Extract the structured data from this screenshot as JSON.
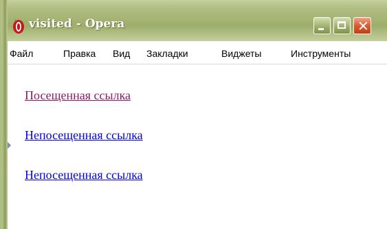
{
  "window": {
    "title": "visited - Opera",
    "icon": "opera-icon",
    "minimize_icon": "minimize-icon",
    "maximize_icon": "maximize-icon",
    "close_icon": "close-icon",
    "close_glyph": "✕"
  },
  "menu": {
    "items": [
      {
        "label": "Файл"
      },
      {
        "label": "Правка"
      },
      {
        "label": "Вид"
      },
      {
        "label": "Закладки"
      },
      {
        "label": "Виджеты"
      },
      {
        "label": "Инструменты"
      }
    ]
  },
  "content": {
    "links": [
      {
        "text": "Посещенная ссылка",
        "state": "visited",
        "color": "#8b1a6b"
      },
      {
        "text": "Непосещенная ссылка",
        "state": "unvisited",
        "color": "#0000ee"
      },
      {
        "text": "Непосещенная ссылка",
        "state": "unvisited",
        "color": "#0000ee"
      }
    ]
  },
  "colors": {
    "titlebar": "#a9b778",
    "close_button": "#dc5a2e"
  }
}
